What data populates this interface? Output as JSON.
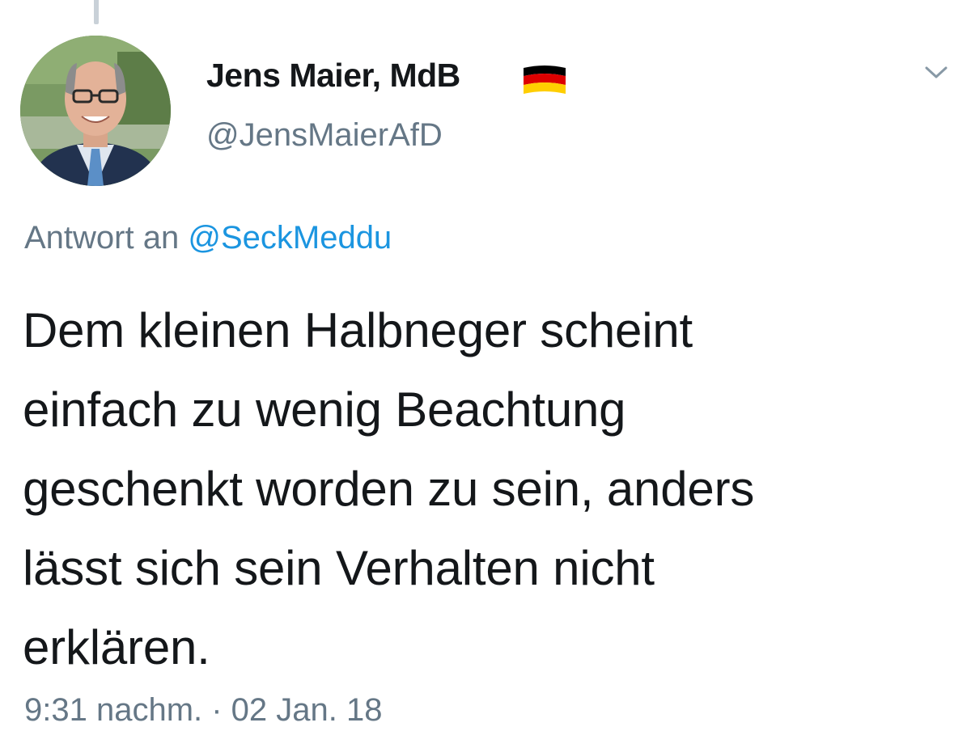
{
  "tweet": {
    "author": {
      "display_name": "Jens Maier, MdB",
      "handle": "@JensMaierAfD",
      "flag_icon": "germany-flag-icon"
    },
    "reply": {
      "prefix": "Antwort an",
      "handle": "@SeckMeddu"
    },
    "text_lines": [
      "Dem kleinen Halbneger scheint",
      "einfach zu wenig Beachtung",
      "geschenkt worden zu sein, anders",
      "lässt sich sein Verhalten nicht",
      "erklären."
    ],
    "timestamp": "9:31 nachm. · 02 Jan. 18",
    "menu_icon": "chevron-down-icon"
  },
  "colors": {
    "text_primary": "#14171a",
    "text_secondary": "#657786",
    "link": "#1b95e0",
    "flag_black": "#000000",
    "flag_red": "#dd0000",
    "flag_gold": "#ffce00"
  }
}
